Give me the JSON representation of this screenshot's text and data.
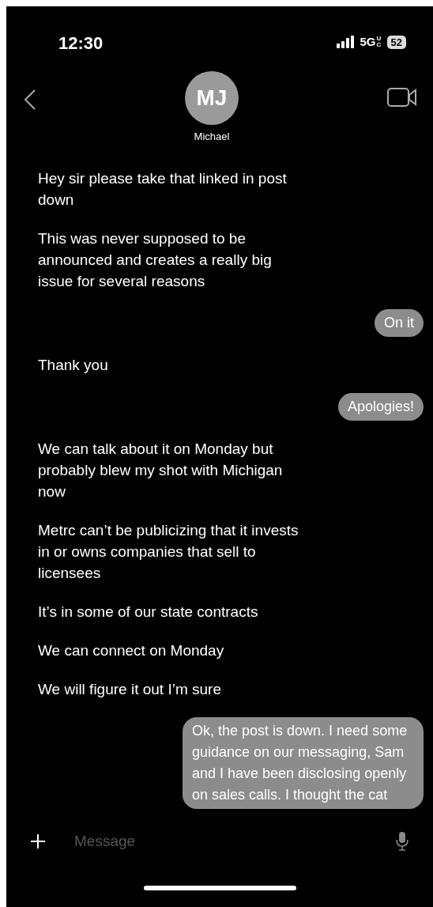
{
  "status_bar": {
    "time": "12:30",
    "network": "5G",
    "network_suffix": "UC",
    "battery": "52"
  },
  "contact": {
    "initials": "MJ",
    "name": "Michael"
  },
  "messages": [
    {
      "kind": "incoming",
      "text": "Hey sir please take that linked in post down"
    },
    {
      "kind": "incoming",
      "text": "This was never supposed to be announced and creates a really big issue for several reasons"
    },
    {
      "kind": "outgoing",
      "text": "On it"
    },
    {
      "kind": "incoming",
      "text": "Thank you"
    },
    {
      "kind": "outgoing",
      "text": "Apologies!"
    },
    {
      "kind": "incoming",
      "text": "We can talk about it on Monday but probably blew my shot with Michigan now"
    },
    {
      "kind": "incoming",
      "text": "Metrc can’t be publicizing that it invests in or owns companies that sell to licensees"
    },
    {
      "kind": "incoming",
      "text": "It’s in some of our state contracts"
    },
    {
      "kind": "incoming",
      "text": "We can connect on Monday"
    },
    {
      "kind": "incoming",
      "text": "We will figure it out I’m sure"
    },
    {
      "kind": "outgoing",
      "text": "Ok, the post is down. I need some guidance on our messaging, Sam and I have been disclosing openly on sales calls. I thought the cat"
    }
  ],
  "composer": {
    "placeholder": "Message"
  }
}
